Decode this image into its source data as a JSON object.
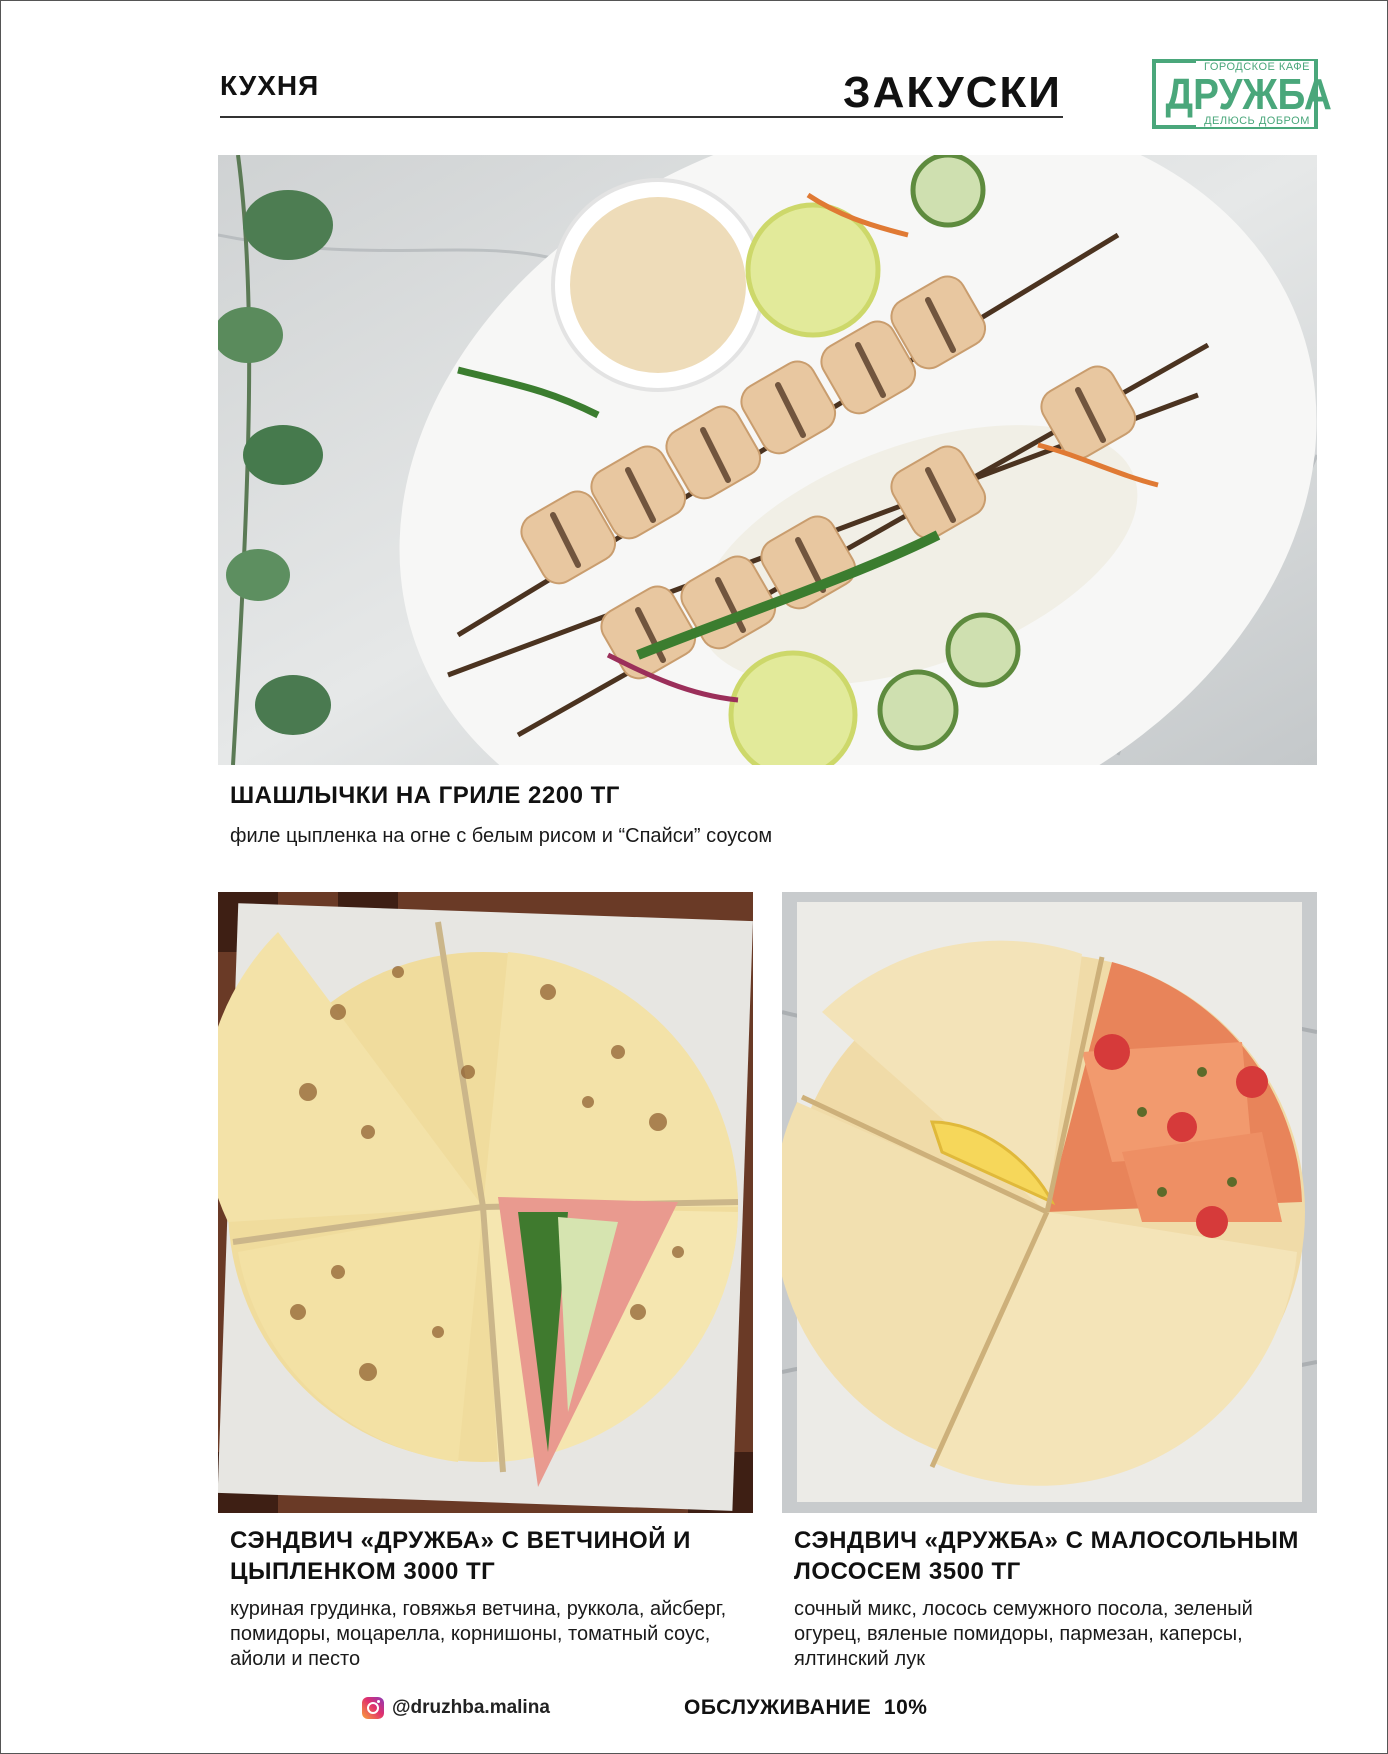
{
  "header": {
    "section": "КУХНЯ",
    "title": "ЗАКУСКИ"
  },
  "logo": {
    "top": "ГОРОДСКОЕ КАФЕ",
    "name": "ДРУЖБА",
    "tagline": "ДЕЛЮСЬ ДОБРОМ",
    "color": "#4aa77b"
  },
  "dishes": [
    {
      "title": "ШАШЛЫЧКИ НА ГРИЛЕ 2200 ТГ",
      "description": "филе цыпленка на огне с белым рисом и “Спайси” соусом"
    },
    {
      "title": "СЭНДВИЧ «ДРУЖБА» С ВЕТЧИНОЙ И ЦЫПЛЕНКОМ 3000 ТГ",
      "description": "куриная грудинка, говяжья ветчина, руккола, айсберг, помидоры, моцарелла, корнишоны, томатный соус, айоли и песто"
    },
    {
      "title": "СЭНДВИЧ «ДРУЖБА» С МАЛОСОЛЬНЫМ ЛОСОСЕМ 3500 ТГ",
      "description": "сочный микс, лосось семужного посола, зеленый огурец, вяленые помидоры, пармезан, каперсы, ялтинский лук"
    }
  ],
  "footer": {
    "instagram": "@druzhba.malina",
    "service": "ОБСЛУЖИВАНИЕ  10%"
  }
}
